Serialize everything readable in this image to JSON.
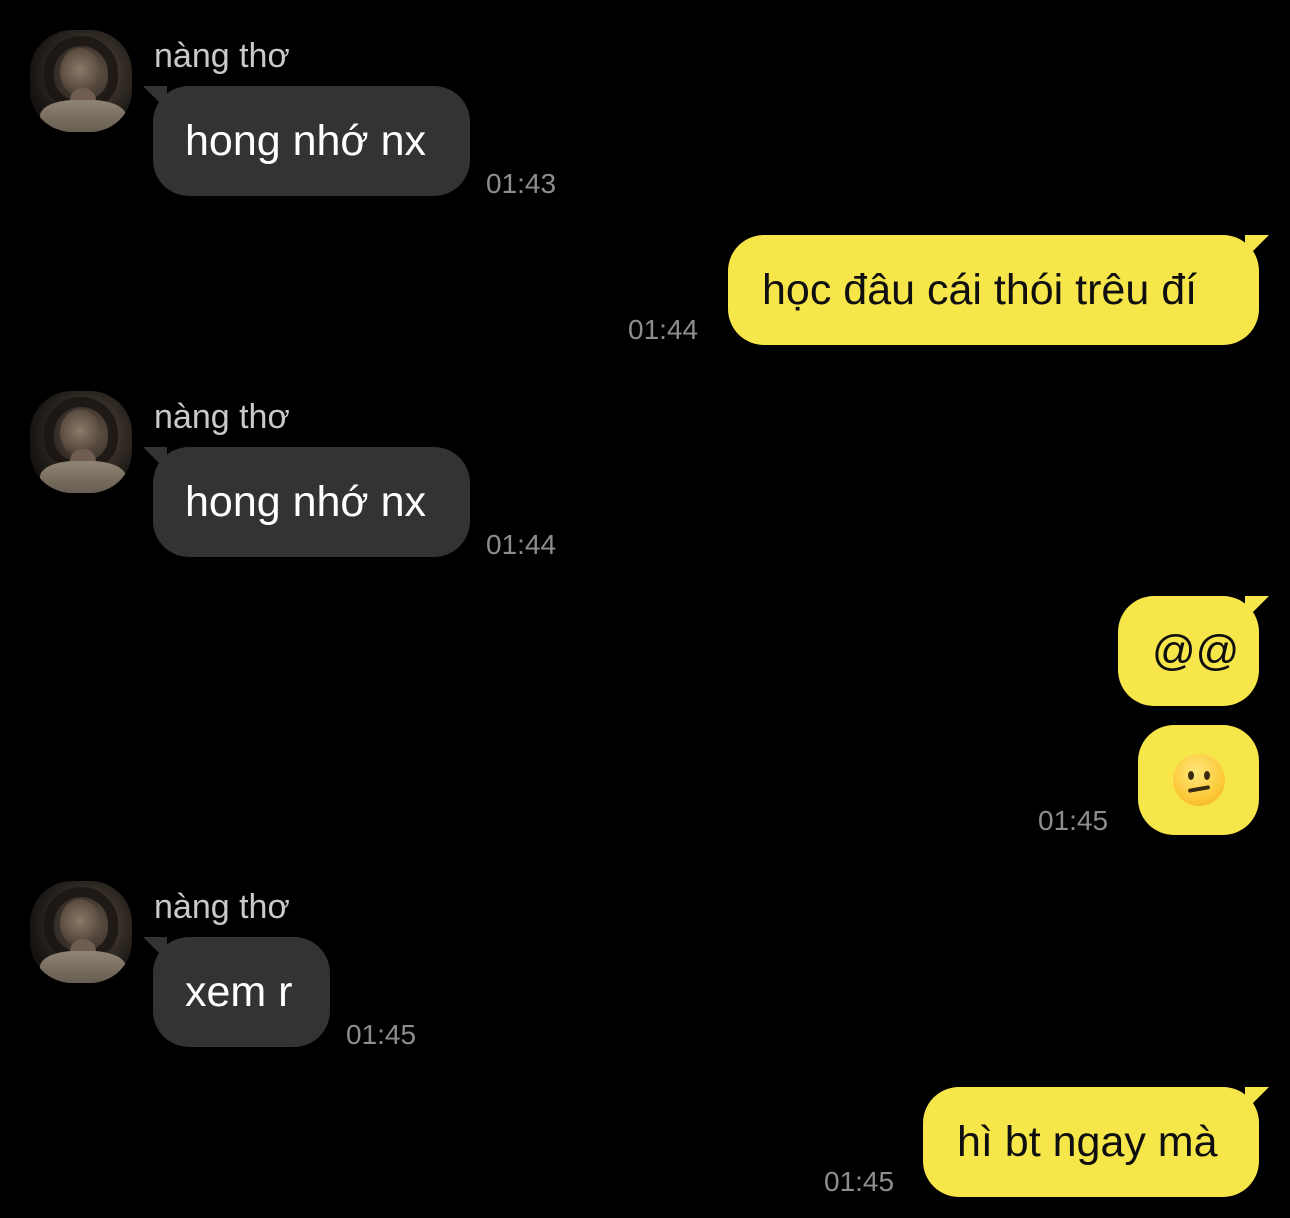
{
  "contact": {
    "name": "nàng thơ"
  },
  "messages": [
    {
      "direction": "incoming",
      "text": "hong nhớ nx",
      "time": "01:43"
    },
    {
      "direction": "outgoing",
      "text": "học đâu cái thói trêu đí",
      "time": "01:44"
    },
    {
      "direction": "incoming",
      "text": "hong nhớ nx",
      "time": "01:44"
    },
    {
      "direction": "outgoing",
      "text": "@@",
      "time": ""
    },
    {
      "direction": "outgoing",
      "emoji": "confused-face-emoji",
      "time": "01:45"
    },
    {
      "direction": "incoming",
      "text": "xem r",
      "time": "01:45"
    },
    {
      "direction": "outgoing",
      "text": "hì bt ngay mà",
      "time": "01:45"
    }
  ],
  "colors": {
    "background": "#000000",
    "incoming_bubble": "#333336",
    "outgoing_bubble": "#f7e64a",
    "timestamp": "#8d8d8d"
  }
}
